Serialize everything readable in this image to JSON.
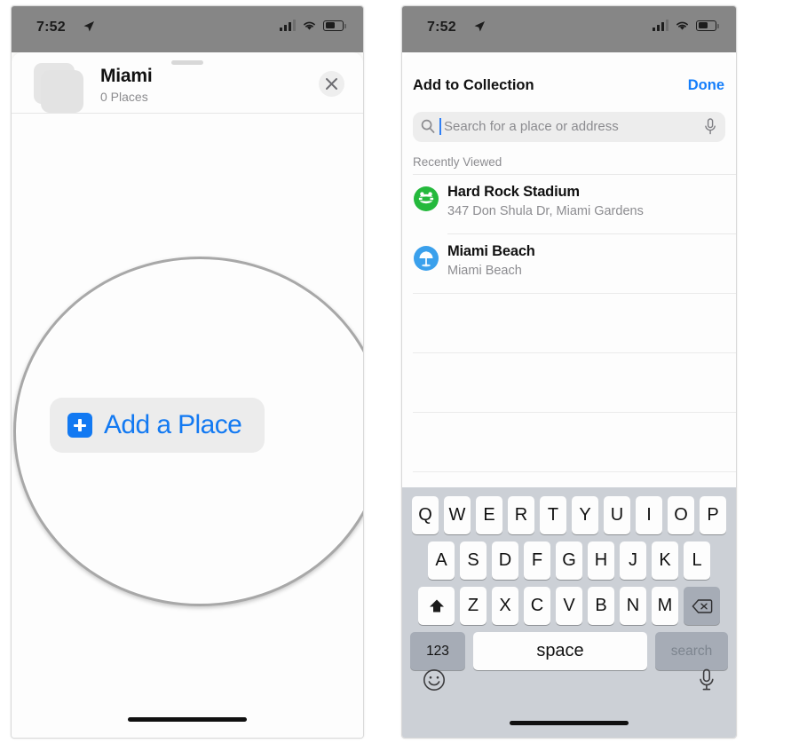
{
  "status_bar": {
    "time": "7:52",
    "location_icon": "location-arrow-icon",
    "cellular_icon": "cellular-bars-icon",
    "wifi_icon": "wifi-icon",
    "battery_icon": "battery-icon"
  },
  "colors": {
    "accent_blue": "#1279f2",
    "link_blue": "#147efb",
    "status_bar_gray": "#868686",
    "keyboard_gray": "#ccd0d6",
    "key_dark_gray": "#a6acb6",
    "stadium_green": "#24b93c",
    "beach_blue": "#3aa0ec",
    "secondary_text": "#8c8c90"
  },
  "left_screen": {
    "collection": {
      "title": "Miami",
      "subtitle": "0 Places",
      "thumbnail_icon": "collection-stack-icon",
      "close_icon": "close-icon",
      "grabber": "sheet-grabber"
    },
    "magnified": {
      "button_label": "Add a Place",
      "button_icon": "plus-square-icon"
    }
  },
  "right_screen": {
    "header": {
      "title": "Add to Collection",
      "done_label": "Done"
    },
    "search": {
      "placeholder": "Search for a place or address",
      "value": "",
      "search_icon": "search-icon",
      "mic_icon": "microphone-icon"
    },
    "section_label": "Recently Viewed",
    "results": [
      {
        "title": "Hard Rock Stadium",
        "subtitle": "347 Don Shula Dr, Miami Gardens",
        "icon": "stadium-icon",
        "icon_color": "#24b93c"
      },
      {
        "title": "Miami Beach",
        "subtitle": "Miami Beach",
        "icon": "beach-umbrella-icon",
        "icon_color": "#3aa0ec"
      }
    ],
    "magnified": {
      "icon": "plus-icon"
    },
    "keyboard": {
      "row1": [
        "Q",
        "W",
        "E",
        "R",
        "T",
        "Y",
        "U",
        "I",
        "O",
        "P"
      ],
      "row2": [
        "A",
        "S",
        "D",
        "F",
        "G",
        "H",
        "J",
        "K",
        "L"
      ],
      "row3": [
        "Z",
        "X",
        "C",
        "V",
        "B",
        "N",
        "M"
      ],
      "shift_icon": "shift-icon",
      "backspace_icon": "backspace-icon",
      "numbers_label": "123",
      "space_label": "space",
      "return_label": "search",
      "emoji_icon": "emoji-icon",
      "dictation_icon": "microphone-icon"
    }
  }
}
